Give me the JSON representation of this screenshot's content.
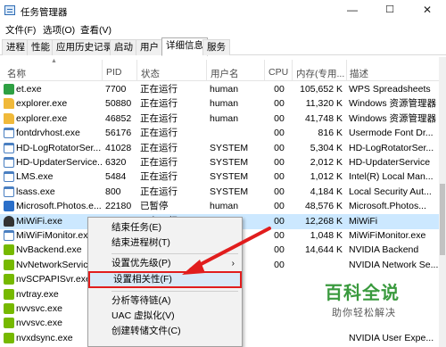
{
  "window": {
    "title": "任务管理器",
    "minimize": "—",
    "maximize": "☐",
    "close": "✕"
  },
  "menu": [
    "文件(F)",
    "选项(O)",
    "查看(V)"
  ],
  "tabs": [
    "进程",
    "性能",
    "应用历史记录",
    "启动",
    "用户",
    "详细信息",
    "服务"
  ],
  "active_tab": "详细信息",
  "columns": [
    "名称",
    "PID",
    "状态",
    "用户名",
    "CPU",
    "内存(专用...",
    "描述"
  ],
  "processes": [
    {
      "name": "et.exe",
      "pid": "7700",
      "status": "正在运行",
      "user": "human",
      "cpu": "00",
      "mem": "105,652 K",
      "desc": "WPS Spreadsheets",
      "icon": "green-s-icon",
      "color": "#2ea043"
    },
    {
      "name": "explorer.exe",
      "pid": "50880",
      "status": "正在运行",
      "user": "human",
      "cpu": "00",
      "mem": "11,320 K",
      "desc": "Windows 资源管理器",
      "icon": "folder-icon",
      "color": "#f0b93a"
    },
    {
      "name": "explorer.exe",
      "pid": "46852",
      "status": "正在运行",
      "user": "human",
      "cpu": "00",
      "mem": "41,748 K",
      "desc": "Windows 资源管理器",
      "icon": "folder-icon",
      "color": "#f0b93a"
    },
    {
      "name": "fontdrvhost.exe",
      "pid": "56176",
      "status": "正在运行",
      "user": "",
      "cpu": "00",
      "mem": "816 K",
      "desc": "Usermode Font Dr...",
      "icon": "window-icon",
      "color": "#4a7fc1"
    },
    {
      "name": "HD-LogRotatorSer...",
      "pid": "41028",
      "status": "正在运行",
      "user": "SYSTEM",
      "cpu": "00",
      "mem": "5,304 K",
      "desc": "HD-LogRotatorSer...",
      "icon": "window-icon",
      "color": "#4a7fc1"
    },
    {
      "name": "HD-UpdaterService...",
      "pid": "6320",
      "status": "正在运行",
      "user": "SYSTEM",
      "cpu": "00",
      "mem": "2,012 K",
      "desc": "HD-UpdaterService",
      "icon": "window-icon",
      "color": "#4a7fc1"
    },
    {
      "name": "LMS.exe",
      "pid": "5484",
      "status": "正在运行",
      "user": "SYSTEM",
      "cpu": "00",
      "mem": "1,012 K",
      "desc": "Intel(R) Local Man...",
      "icon": "window-icon",
      "color": "#4a7fc1"
    },
    {
      "name": "lsass.exe",
      "pid": "800",
      "status": "正在运行",
      "user": "SYSTEM",
      "cpu": "00",
      "mem": "4,184 K",
      "desc": "Local Security Aut...",
      "icon": "window-icon",
      "color": "#4a7fc1"
    },
    {
      "name": "Microsoft.Photos.e...",
      "pid": "22180",
      "status": "已暂停",
      "user": "human",
      "cpu": "00",
      "mem": "48,576 K",
      "desc": "Microsoft.Photos...",
      "icon": "photos-icon",
      "color": "#2b6fc9"
    },
    {
      "name": "MiWiFi.exe",
      "pid": "65200",
      "status": "正在运行",
      "user": "human",
      "cpu": "00",
      "mem": "12,268 K",
      "desc": "MiWiFi",
      "icon": "wifi-icon",
      "color": "#333333"
    },
    {
      "name": "MiWiFiMonitor.exe",
      "pid": "",
      "status": "",
      "user": "",
      "cpu": "00",
      "mem": "1,048 K",
      "desc": "MiWiFiMonitor.exe",
      "icon": "window-icon",
      "color": "#4a7fc1"
    },
    {
      "name": "NvBackend.exe",
      "pid": "",
      "status": "",
      "user": "",
      "cpu": "00",
      "mem": "14,644 K",
      "desc": "NVIDIA Backend",
      "icon": "nvidia-icon",
      "color": "#76b900"
    },
    {
      "name": "NvNetworkService...",
      "pid": "",
      "status": "",
      "user": "",
      "cpu": "00",
      "mem": "",
      "desc": "NVIDIA Network Se...",
      "icon": "nvidia-icon",
      "color": "#76b900"
    },
    {
      "name": "nvSCPAPISvr.exe",
      "pid": "",
      "status": "",
      "user": "",
      "cpu": "",
      "mem": "",
      "desc": "",
      "icon": "nvidia-icon",
      "color": "#76b900"
    },
    {
      "name": "nvtray.exe",
      "pid": "",
      "status": "",
      "user": "",
      "cpu": "",
      "mem": "",
      "desc": "",
      "icon": "nvidia-icon",
      "color": "#76b900"
    },
    {
      "name": "nvvsvc.exe",
      "pid": "",
      "status": "",
      "user": "",
      "cpu": "",
      "mem": "",
      "desc": "",
      "icon": "nvidia-icon",
      "color": "#76b900"
    },
    {
      "name": "nvvsvc.exe",
      "pid": "",
      "status": "",
      "user": "",
      "cpu": "",
      "mem": "",
      "desc": "",
      "icon": "nvidia-icon",
      "color": "#76b900"
    },
    {
      "name": "nvxdsync.exe",
      "pid": "",
      "status": "",
      "user": "",
      "cpu": "",
      "mem": "",
      "desc": "NVIDIA User Expe...",
      "icon": "nvidia-icon",
      "color": "#76b900"
    }
  ],
  "selected_process": "MiWiFi.exe",
  "context_menu": {
    "items": [
      "结束任务(E)",
      "结束进程树(T)",
      "设置优先级(P)",
      "设置相关性(F)",
      "分析等待链(A)",
      "UAC 虚拟化(V)",
      "创建转储文件(C)"
    ],
    "highlighted": "设置相关性(F)",
    "submenu_chevron": "›"
  },
  "watermark": {
    "title": "百科全说",
    "subtitle": "助你轻松解决"
  },
  "colors": {
    "accent_red": "#e11d1d",
    "selection_blue": "#cce8ff",
    "watermark_green": "#3a9a3e"
  }
}
